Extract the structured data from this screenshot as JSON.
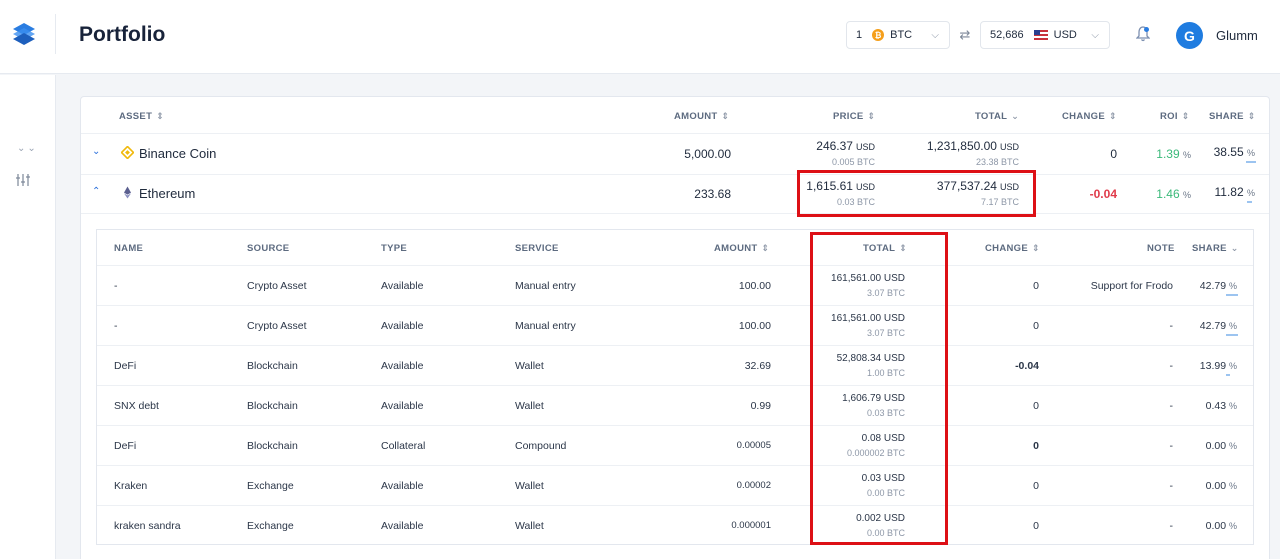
{
  "header": {
    "title": "Portfolio",
    "converter": {
      "from_amount": "1",
      "from_currency": "BTC",
      "to_amount": "52,686",
      "to_currency": "USD"
    },
    "user": {
      "initial": "G",
      "name": "Glumm"
    }
  },
  "assets_table": {
    "headers": {
      "asset": "ASSET",
      "amount": "AMOUNT",
      "price": "PRICE",
      "total": "TOTAL",
      "change": "CHANGE",
      "roi": "ROI",
      "share": "SHARE"
    },
    "rows": [
      {
        "name": "Binance Coin",
        "amount": "5,000.00",
        "price_usd": "246.37",
        "price_btc": "0.005 BTC",
        "total_usd": "1,231,850.00",
        "total_btc": "23.38 BTC",
        "change": "0",
        "roi": "1.39",
        "share": "38.55"
      },
      {
        "name": "Ethereum",
        "amount": "233.68",
        "price_usd": "1,615.61",
        "price_btc": "0.03 BTC",
        "total_usd": "377,537.24",
        "total_btc": "7.17 BTC",
        "change": "-0.04",
        "roi": "1.46",
        "share": "11.82"
      }
    ],
    "usd_unit": "USD",
    "pct_unit": "%"
  },
  "details_table": {
    "headers": {
      "name": "NAME",
      "source": "SOURCE",
      "type": "TYPE",
      "service": "SERVICE",
      "amount": "AMOUNT",
      "total": "TOTAL",
      "change": "CHANGE",
      "note": "NOTE",
      "share": "SHARE"
    },
    "rows": [
      {
        "name": "-",
        "source": "Crypto Asset",
        "type": "Available",
        "service": "Manual entry",
        "amount": "100.00",
        "total_usd": "161,561.00 USD",
        "total_btc": "3.07 BTC",
        "change": "0",
        "note": "Support for Frodo",
        "share": "42.79"
      },
      {
        "name": "-",
        "source": "Crypto Asset",
        "type": "Available",
        "service": "Manual entry",
        "amount": "100.00",
        "total_usd": "161,561.00 USD",
        "total_btc": "3.07 BTC",
        "change": "0",
        "note": "-",
        "share": "42.79"
      },
      {
        "name": "DeFi",
        "source": "Blockchain",
        "type": "Available",
        "service": "Wallet",
        "amount": "32.69",
        "total_usd": "52,808.34 USD",
        "total_btc": "1.00 BTC",
        "change": "-0.04",
        "note": "-",
        "share": "13.99"
      },
      {
        "name": "SNX debt",
        "source": "Blockchain",
        "type": "Available",
        "service": "Wallet",
        "amount": "0.99",
        "total_usd": "1,606.79 USD",
        "total_btc": "0.03 BTC",
        "change": "0",
        "note": "-",
        "share": "0.43"
      },
      {
        "name": "DeFi",
        "source": "Blockchain",
        "type": "Collateral",
        "service": "Compound",
        "amount": "0.00005",
        "total_usd": "0.08 USD",
        "total_btc": "0.000002 BTC",
        "change": "0",
        "note": "-",
        "share": "0.00"
      },
      {
        "name": "Kraken",
        "source": "Exchange",
        "type": "Available",
        "service": "Wallet",
        "amount": "0.00002",
        "total_usd": "0.03 USD",
        "total_btc": "0.00 BTC",
        "change": "0",
        "note": "-",
        "share": "0.00"
      },
      {
        "name": "kraken sandra",
        "source": "Exchange",
        "type": "Available",
        "service": "Wallet",
        "amount": "0.000001",
        "total_usd": "0.002 USD",
        "total_btc": "0.00 BTC",
        "change": "0",
        "note": "-",
        "share": "0.00"
      }
    ]
  },
  "colors": {
    "accent": "#1f7ce0",
    "negative": "#e03a4a",
    "positive": "#3bb97a",
    "highlight": "#dd1016"
  }
}
